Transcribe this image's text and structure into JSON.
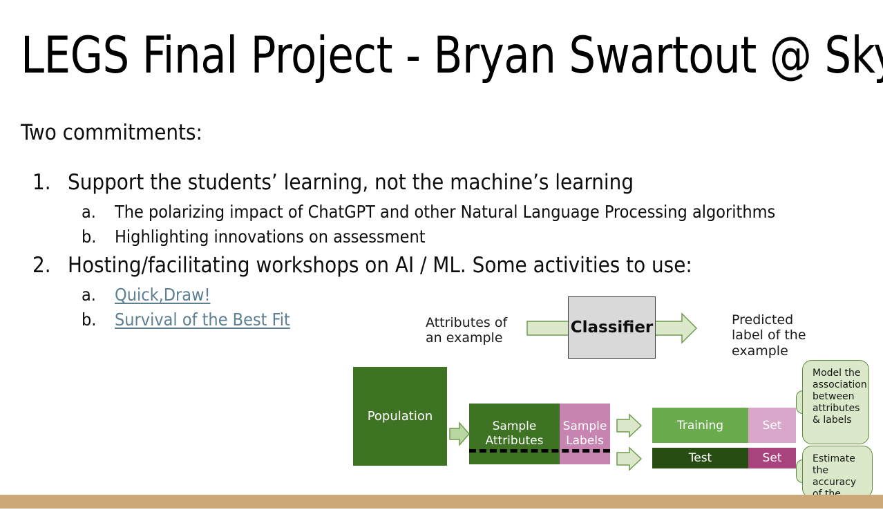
{
  "slide": {
    "title": "LEGS Final Project - Bryan Swartout @ Skyline",
    "lead": "Two commitments:",
    "items": [
      {
        "marker": "1.",
        "text": "Support the students’ learning, not the machine’s learning",
        "sub": [
          {
            "marker": "a.",
            "text": "The polarizing impact of ChatGPT and other Natural Language Processing algorithms",
            "is_link": false
          },
          {
            "marker": "b.",
            "text": "Highlighting innovations on assessment",
            "is_link": false
          }
        ]
      },
      {
        "marker": "2.",
        "text": "Hosting/facilitating workshops on AI / ML. Some activities to use:",
        "sub": [
          {
            "marker": "a.",
            "text": "Quick,Draw!",
            "is_link": true
          },
          {
            "marker": "b.",
            "text": "Survival of the Best Fit",
            "is_link": true
          }
        ]
      }
    ]
  },
  "diagram": {
    "attributes_label": "Attributes of\nan example",
    "attributes_label_line1": "Attributes of",
    "attributes_label_line2": "an example",
    "classifier_label": "Classifier",
    "predicted_label_line1": "Predicted",
    "predicted_label_line2": "label of the",
    "predicted_label_line3": "example",
    "population_label": "Population",
    "sample_attributes_line1": "Sample",
    "sample_attributes_line2": "Attributes",
    "sample_labels_line1": "Sample",
    "sample_labels_line2": "Labels",
    "training_label": "Training",
    "training_set_label": "Set",
    "test_label": "Test",
    "test_set_label": "Set",
    "callout_1": "Model the association between attributes & labels",
    "callout_2": "Estimate the accuracy of the classifier"
  },
  "colors": {
    "link": "#5c7f91",
    "dark_green": "#3f7324",
    "mid_green": "#6aab4d",
    "darkest_green": "#274d13",
    "pink": "#c784b0",
    "light_pink": "#d9a7c9",
    "magenta": "#a8437e",
    "callout_fill": "#dbe9ca",
    "callout_border": "#5f8a3f",
    "classifier_fill": "#d9d9d9",
    "bottom_bar": "#cda878",
    "arrow_fill": "#dbe9ca",
    "arrow_border": "#6f9b4f"
  }
}
